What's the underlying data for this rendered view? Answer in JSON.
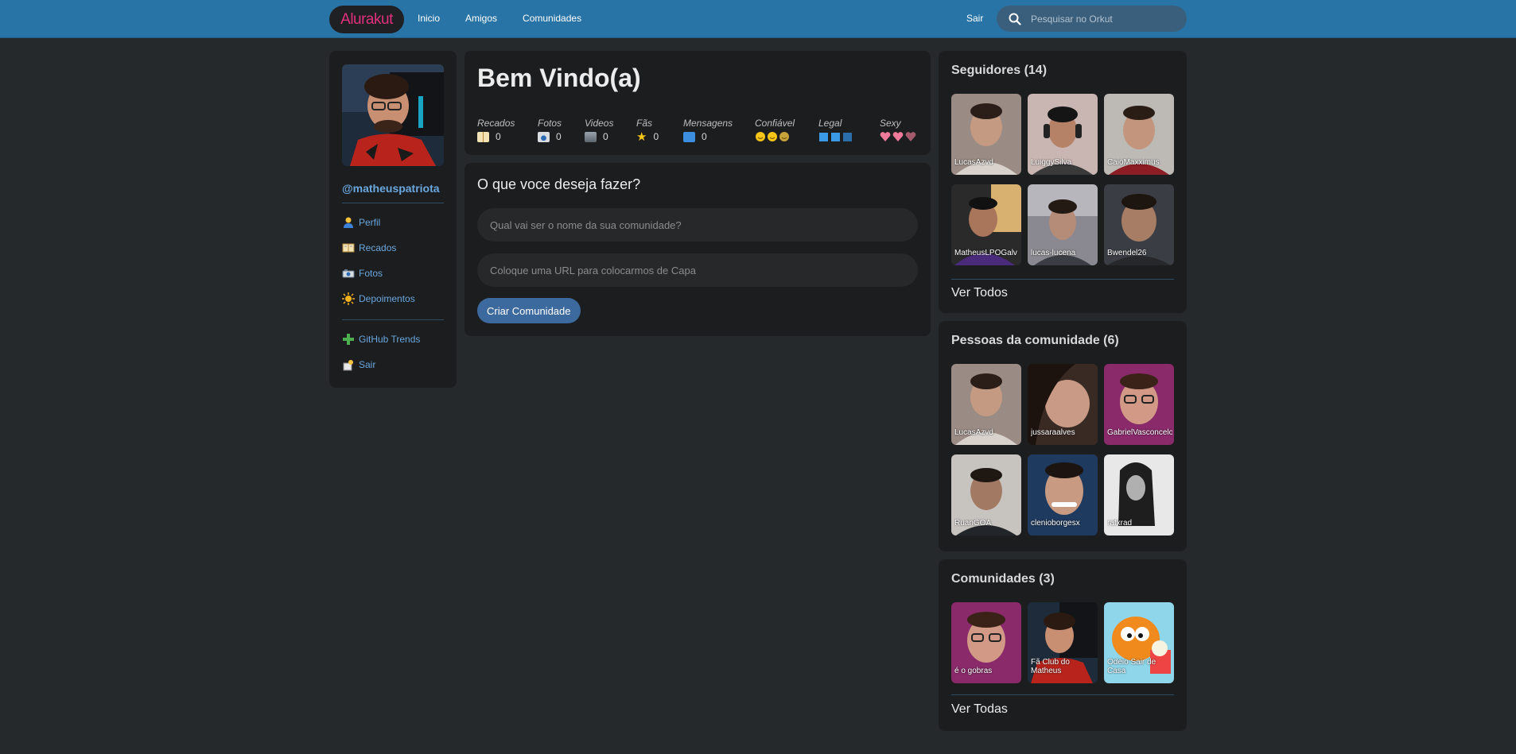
{
  "topbar": {
    "logo": "Alurakut",
    "nav": [
      "Inicio",
      "Amigos",
      "Comunidades"
    ],
    "logout": "Sair",
    "search_placeholder": "Pesquisar no Orkut"
  },
  "profile": {
    "username": "@matheuspatriota",
    "menu": [
      "Perfil",
      "Recados",
      "Fotos",
      "Depoimentos"
    ],
    "menu2": [
      "GitHub Trends",
      "Sair"
    ]
  },
  "welcome": {
    "title": "Bem Vindo(a)",
    "stats": [
      {
        "label": "Recados",
        "value": "0"
      },
      {
        "label": "Fotos",
        "value": "0"
      },
      {
        "label": "Videos",
        "value": "0"
      },
      {
        "label": "Fãs",
        "value": "0"
      },
      {
        "label": "Mensagens",
        "value": "0"
      },
      {
        "label": "Confiável",
        "value": ""
      },
      {
        "label": "Legal",
        "value": ""
      },
      {
        "label": "Sexy",
        "value": ""
      }
    ]
  },
  "form": {
    "title": "O que voce deseja fazer?",
    "name_placeholder": "Qual vai ser o nome da sua comunidade?",
    "url_placeholder": "Coloque uma URL para colocarmos de Capa",
    "button": "Criar Comunidade"
  },
  "followers": {
    "title": "Seguidores (14)",
    "items": [
      "LucasAzvd",
      "LuiggySilva",
      "CaioMaxximus",
      "MatheusLPOGalv",
      "lucas-lucena",
      "Bwendel26"
    ],
    "see_all": "Ver Todos"
  },
  "people": {
    "title": "Pessoas da comunidade (6)",
    "items": [
      "LucasAzvd",
      "jussaraalves",
      "GabrielVasconcelo",
      "RuanGOA",
      "clenioborgesx",
      "rafxrad"
    ]
  },
  "communities": {
    "title": "Comunidades (3)",
    "items": [
      "é o gobras",
      "Fã Club do Matheus",
      "Odeio Sair de Casa"
    ],
    "see_all": "Ver Todas"
  },
  "colors": {
    "topbar": "#2874a6",
    "background": "#26292b",
    "box": "#1c1d1f",
    "link": "#6aa7de",
    "logo": "#e3307e",
    "button": "#3d6a9e"
  }
}
